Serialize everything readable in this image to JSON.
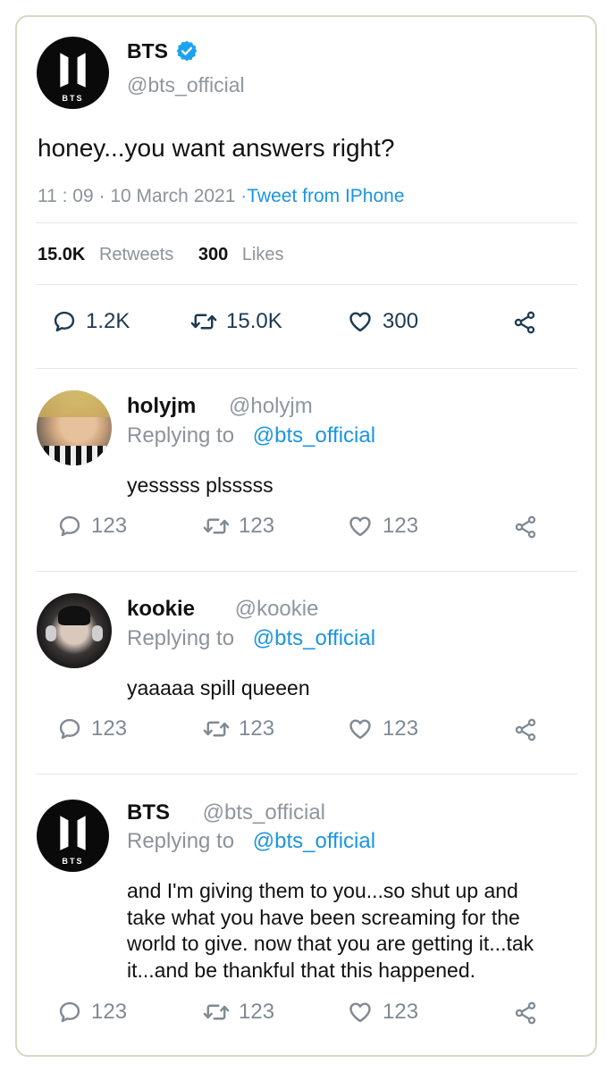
{
  "main_tweet": {
    "display_name": "BTS",
    "handle": "@bts_official",
    "text": "honey...you want answers right?",
    "timestamp": "11 : 09 · 10 March 2021 ·",
    "source": "Tweet from IPhone",
    "retweets_count": "15.0K",
    "retweets_label": "Retweets",
    "likes_count": "300",
    "likes_label": "Likes",
    "actions": {
      "replies": "1.2K",
      "retweets": "15.0K",
      "likes": "300"
    }
  },
  "replies": [
    {
      "display_name": "holyjm",
      "handle": "@holyjm",
      "replying_label": "Replying to",
      "replying_to": "@bts_official",
      "text": "yesssss plsssss",
      "actions": {
        "replies": "123",
        "retweets": "123",
        "likes": "123"
      }
    },
    {
      "display_name": "kookie",
      "handle": "@kookie",
      "replying_label": "Replying to",
      "replying_to": "@bts_official",
      "text": "yaaaaa spill queeen",
      "actions": {
        "replies": "123",
        "retweets": "123",
        "likes": "123"
      }
    },
    {
      "display_name": "BTS",
      "handle": "@bts_official",
      "replying_label": "Replying to",
      "replying_to": "@bts_official",
      "text_lines": [
        "and I'm giving them to you...so shut up and",
        "take what you have been screaming for the",
        "world to give. now that you are getting it...tak",
        "it...and be thankful that this happened."
      ],
      "actions": {
        "replies": "123",
        "retweets": "123",
        "likes": "123"
      }
    }
  ],
  "logo_text": "BTS",
  "colors": {
    "link_blue": "#1b95e0",
    "verified": "#1da1f2",
    "border": "#d9d6c4"
  },
  "icons": [
    "verified-badge-icon",
    "reply-icon",
    "retweet-icon",
    "like-icon",
    "share-icon"
  ]
}
